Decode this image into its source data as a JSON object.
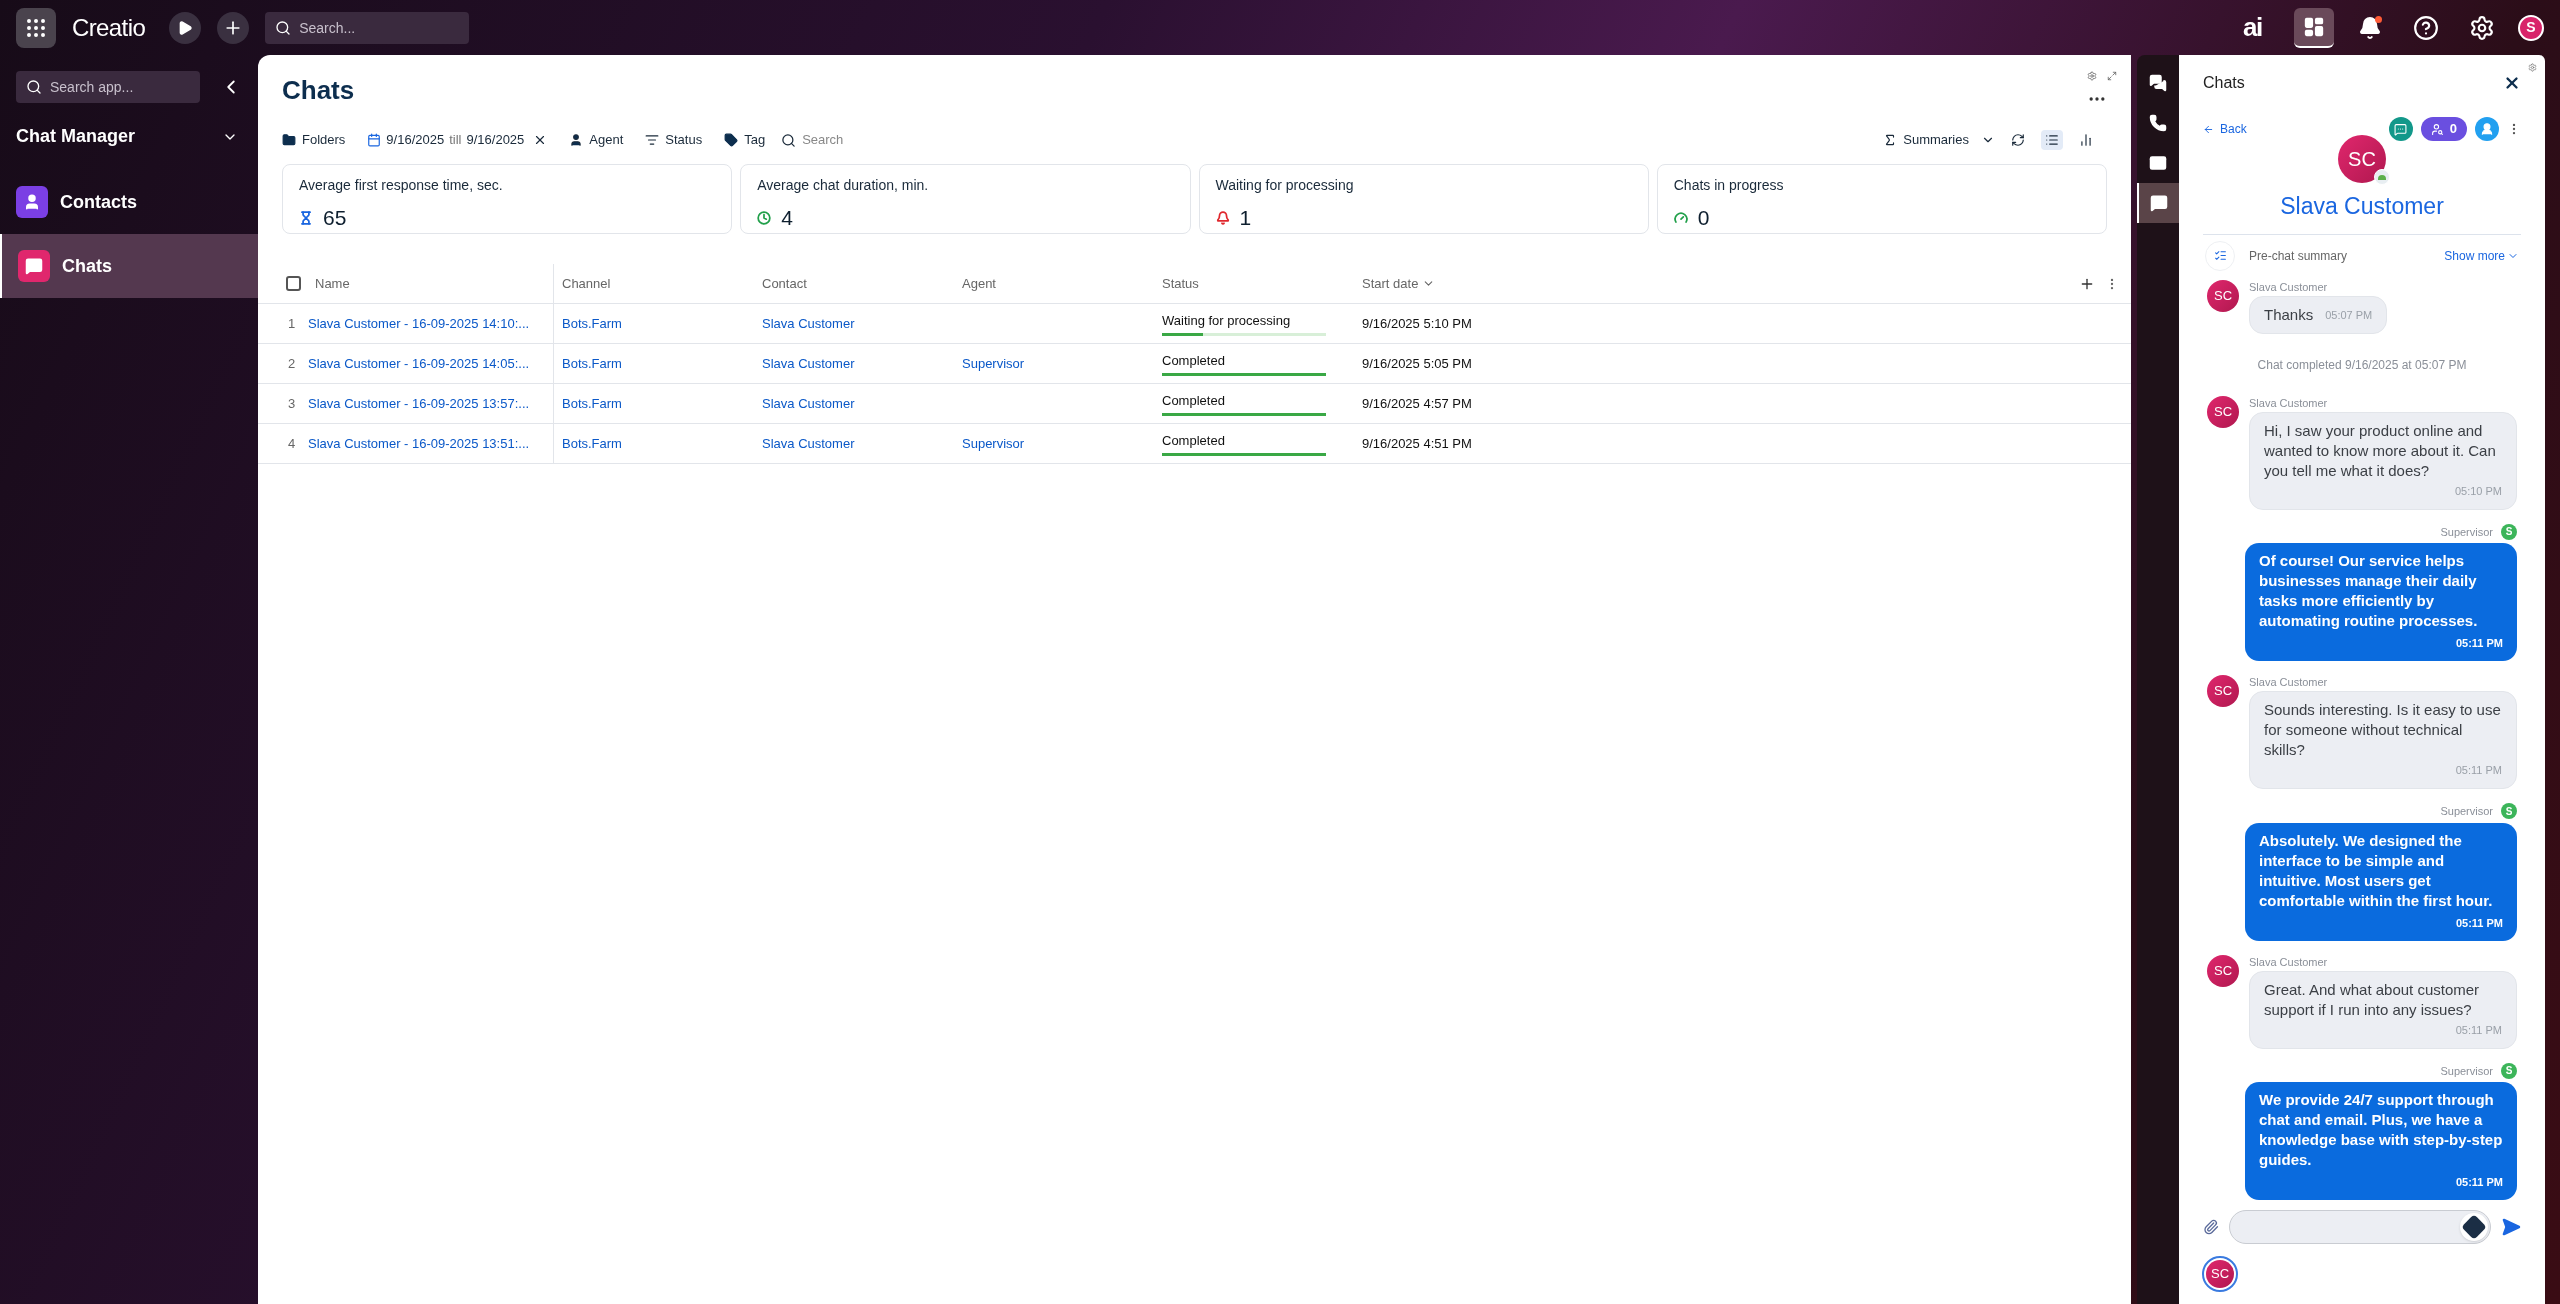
{
  "topbar": {
    "logo": "Creatio",
    "search": {
      "placeholder": "Search..."
    },
    "ai_label": "ai",
    "notifications": {
      "unread": true
    },
    "avatar": "S"
  },
  "sidebar": {
    "search": {
      "placeholder": "Search app..."
    },
    "workplace": "Chat Manager",
    "items": [
      {
        "label": "Contacts",
        "selected": false,
        "color": "#7b3fe4",
        "kind": "contact"
      },
      {
        "label": "Chats",
        "selected": true,
        "color": "#e0276d",
        "kind": "chat"
      }
    ]
  },
  "page": {
    "title": "Chats",
    "filters": {
      "folders": "Folders",
      "date_from": "9/16/2025",
      "date_sep": "till",
      "date_to": "9/16/2025",
      "agent": "Agent",
      "status": "Status",
      "tag": "Tag",
      "search": {
        "placeholder": "Search"
      },
      "summaries": "Summaries"
    },
    "cards": [
      {
        "label": "Average first response time, sec.",
        "value": "65",
        "kind": "hourglass",
        "color": "#1a66e0"
      },
      {
        "label": "Average chat duration, min.",
        "value": "4",
        "kind": "clock",
        "color": "#22a04b"
      },
      {
        "label": "Waiting for processing",
        "value": "1",
        "kind": "bell",
        "color": "#e0282e"
      },
      {
        "label": "Chats in progress",
        "value": "0",
        "kind": "gauge",
        "color": "#22a04b"
      }
    ],
    "table": {
      "select_all": {
        "checked": false
      },
      "columns": [
        {
          "label": "Name",
          "sorted": false
        },
        {
          "label": "Channel",
          "sorted": false
        },
        {
          "label": "Contact",
          "sorted": false
        },
        {
          "label": "Agent",
          "sorted": false
        },
        {
          "label": "Status",
          "sorted": false
        },
        {
          "label": "Start date",
          "sorted": true
        }
      ],
      "rows": [
        {
          "number": "1",
          "name": "Slava Customer - 16-09-2025 14:10:...",
          "channel": "Bots.Farm",
          "contact": "Slava Customer",
          "agent": "",
          "status": "Waiting for processing",
          "level": 0.25,
          "start": "9/16/2025 5:10 PM"
        },
        {
          "number": "2",
          "name": "Slava Customer - 16-09-2025 14:05:...",
          "channel": "Bots.Farm",
          "contact": "Slava Customer",
          "agent": "Supervisor",
          "status": "Completed",
          "level": 1,
          "start": "9/16/2025 5:05 PM"
        },
        {
          "number": "3",
          "name": "Slava Customer - 16-09-2025 13:57:...",
          "channel": "Bots.Farm",
          "contact": "Slava Customer",
          "agent": "",
          "status": "Completed",
          "level": 1,
          "start": "9/16/2025 4:57 PM"
        },
        {
          "number": "4",
          "name": "Slava Customer - 16-09-2025 13:51:...",
          "channel": "Bots.Farm",
          "contact": "Slava Customer",
          "agent": "Supervisor",
          "status": "Completed",
          "level": 1,
          "start": "9/16/2025 4:51 PM"
        }
      ]
    }
  },
  "comm_strip": [
    {
      "kind": "chats",
      "selected": false
    },
    {
      "kind": "phone",
      "selected": false
    },
    {
      "kind": "email",
      "selected": false
    },
    {
      "kind": "chat",
      "selected": true
    }
  ],
  "chat_panel": {
    "title": "Chats",
    "back": "Back",
    "participants_count": "0",
    "contact": {
      "initials": "SC",
      "name": "Slava Customer"
    },
    "pre_chat": "Pre-chat summary",
    "show_more": "Show more",
    "messages": [
      {
        "kind": "incoming",
        "sender": "Slava Customer",
        "avatar": "SC",
        "text": "Thanks",
        "time": "05:07 PM"
      },
      {
        "kind": "system",
        "text": "Chat completed 9/16/2025 at 05:07 PM"
      },
      {
        "kind": "incoming",
        "sender": "Slava Customer",
        "avatar": "SC",
        "text": "Hi, I saw your product online and wanted to know more about it. Can you tell me what it does?",
        "time": "05:10 PM"
      },
      {
        "kind": "outgoing",
        "sender": "Supervisor",
        "avatar": "S",
        "text": "Of course! Our service helps businesses manage their daily tasks more efficiently by automating routine processes.",
        "time": "05:11 PM"
      },
      {
        "kind": "incoming",
        "sender": "Slava Customer",
        "avatar": "SC",
        "text": "Sounds interesting. Is it easy to use for someone without technical skills?",
        "time": "05:11 PM"
      },
      {
        "kind": "outgoing",
        "sender": "Supervisor",
        "avatar": "S",
        "text": "Absolutely. We designed the interface to be simple and intuitive. Most users get comfortable within the first hour.",
        "time": "05:11 PM"
      },
      {
        "kind": "incoming",
        "sender": "Slava Customer",
        "avatar": "SC",
        "text": "Great. And what about customer support if I run into any issues?",
        "time": "05:11 PM"
      },
      {
        "kind": "outgoing",
        "sender": "Supervisor",
        "avatar": "S",
        "text": "We provide 24/7 support through chat and email. Plus, we have a knowledge base with step-by-step guides.",
        "time": "05:11 PM"
      }
    ],
    "footer_avatar": "SC"
  }
}
